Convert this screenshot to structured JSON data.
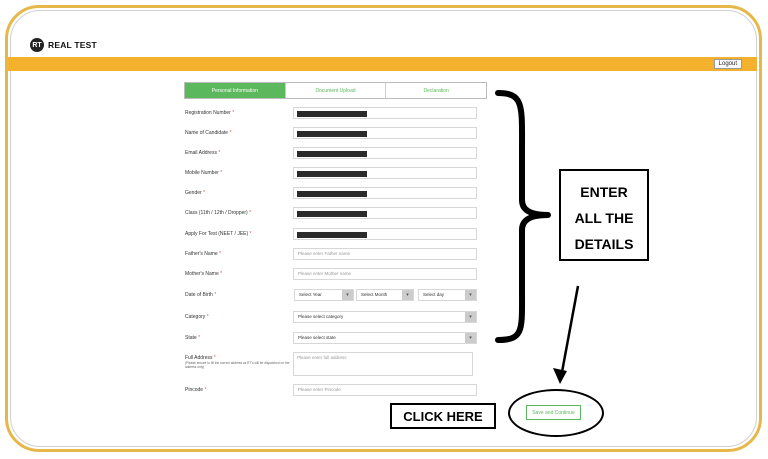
{
  "brand": {
    "logo_text": "REAL TEST",
    "logo_glyph": "RT"
  },
  "header": {
    "logout_label": "Logout"
  },
  "tabs": [
    {
      "label": "Personal Information",
      "active": true
    },
    {
      "label": "Document Upload",
      "active": false
    },
    {
      "label": "Declaration",
      "active": false
    }
  ],
  "form": {
    "registration_number": {
      "label": "Registration Number",
      "required": "*"
    },
    "name_of_candidate": {
      "label": "Name of Candidate",
      "required": "*"
    },
    "email_address": {
      "label": "Email Address",
      "required": "*"
    },
    "mobile_number": {
      "label": "Mobile Number",
      "required": "*"
    },
    "gender": {
      "label": "Gender",
      "required": "*"
    },
    "class": {
      "label": "Class (11th / 12th / Dropper)",
      "required": "*"
    },
    "apply_for_test": {
      "label": "Apply For Test (NEET / JEE)",
      "required": "*"
    },
    "fathers_name": {
      "label": "Father's Name",
      "required": "*",
      "placeholder": "Please enter Father name"
    },
    "mothers_name": {
      "label": "Mother's Name",
      "required": "*",
      "placeholder": "Please enter Mother name"
    },
    "date_of_birth": {
      "label": "Date of Birth",
      "required": "*",
      "year": "Select Year",
      "month": "Select Month",
      "day": "Select day"
    },
    "category": {
      "label": "Category",
      "required": "*",
      "value": "Please select category"
    },
    "state": {
      "label": "State",
      "required": "*",
      "value": "Please select state"
    },
    "full_address": {
      "label": "Full Address",
      "required": "*",
      "note": "(Please ensure to fill the correct address as RT's will be dispatched on the address only)",
      "placeholder": "Please enter full address"
    },
    "pincode": {
      "label": "Pincode",
      "required": "*",
      "placeholder": "Please enter Pincode"
    }
  },
  "actions": {
    "save_label": "Save and Continue"
  },
  "annotations": {
    "enter_lines": [
      "ENTER",
      "ALL THE",
      "DETAILS"
    ],
    "click_here": "CLICK HERE"
  },
  "colors": {
    "accent_green": "#5cb85c",
    "bar_yellow": "#f3b12d",
    "frame_gold": "#e6b84a",
    "required_red": "#d9534f"
  }
}
